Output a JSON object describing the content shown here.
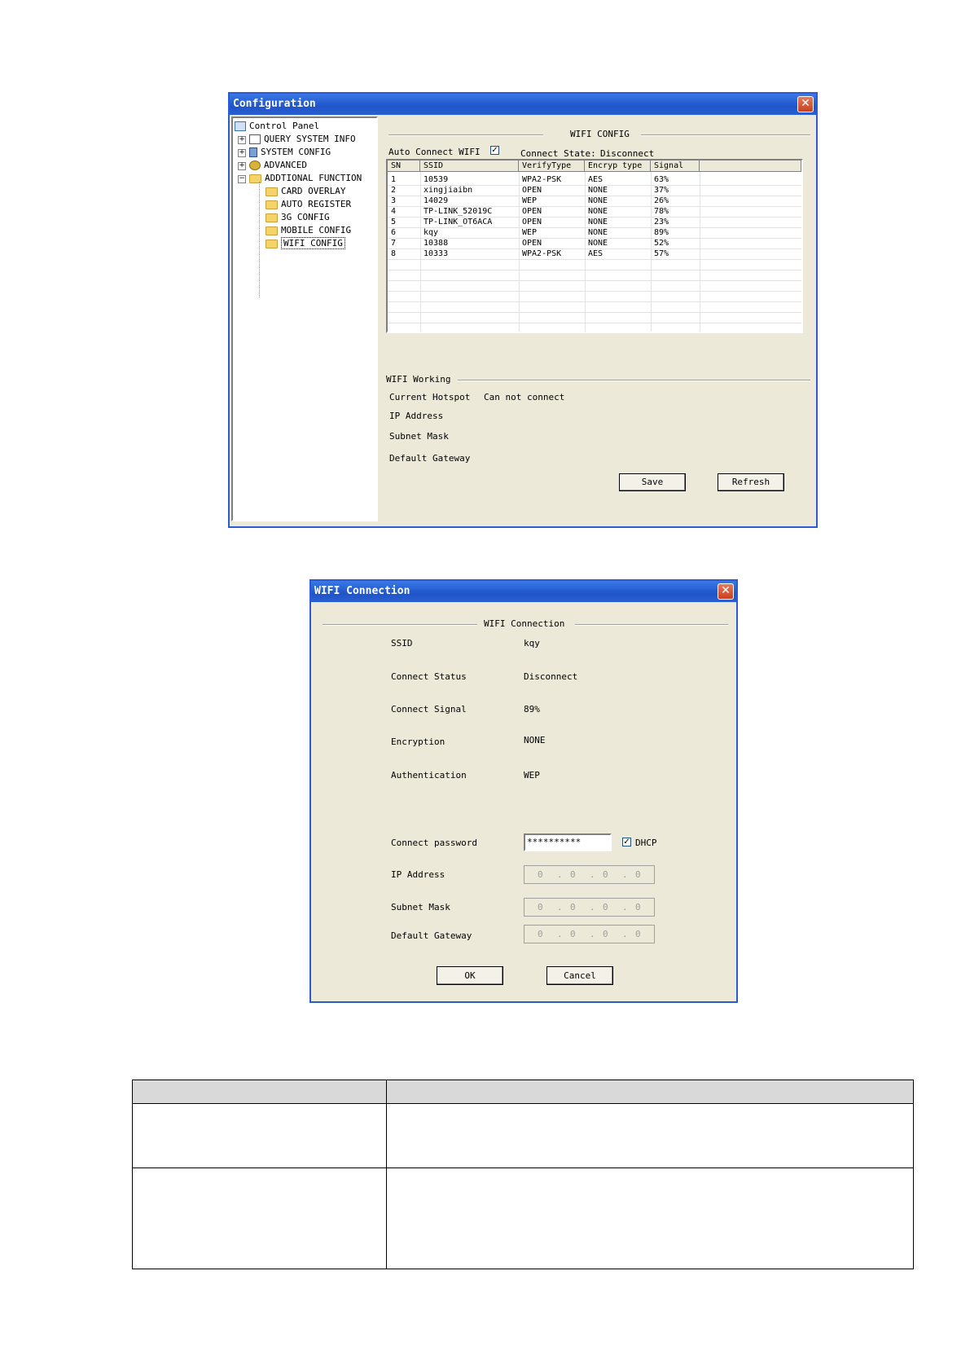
{
  "config_window": {
    "title": "Configuration",
    "tree": {
      "root": "Control Panel",
      "items": [
        {
          "label": "QUERY SYSTEM INFO"
        },
        {
          "label": "SYSTEM CONFIG"
        },
        {
          "label": "ADVANCED"
        },
        {
          "label": "ADDTIONAL FUNCTION"
        },
        {
          "label": "CARD OVERLAY"
        },
        {
          "label": "AUTO REGISTER"
        },
        {
          "label": "3G CONFIG"
        },
        {
          "label": "MOBILE CONFIG"
        },
        {
          "label": "WIFI CONFIG"
        }
      ]
    },
    "section_title": "WIFI CONFIG",
    "auto_connect_label": "Auto Connect WIFI",
    "auto_connect_checked": "✓",
    "connect_state_label": "Connect State:",
    "connect_state_value": "Disconnect",
    "table": {
      "headers": [
        "SN",
        "SSID",
        "VerifyType",
        "Encryp type",
        "Signal"
      ],
      "rows": [
        [
          "1",
          "10539",
          "WPA2-PSK",
          "AES",
          "63%"
        ],
        [
          "2",
          "xingjiaibn",
          "OPEN",
          "NONE",
          "37%"
        ],
        [
          "3",
          "14029",
          "WEP",
          "NONE",
          "26%"
        ],
        [
          "4",
          "TP-LINK_52019C",
          "OPEN",
          "NONE",
          "78%"
        ],
        [
          "5",
          "TP-LINK_OT6ACA",
          "OPEN",
          "NONE",
          "23%"
        ],
        [
          "6",
          "kqy",
          "WEP",
          "NONE",
          "89%"
        ],
        [
          "7",
          "10388",
          "OPEN",
          "NONE",
          "52%"
        ],
        [
          "8",
          "10333",
          "WPA2-PSK",
          "AES",
          "57%"
        ]
      ]
    },
    "working_title": "WIFI Working",
    "current_hotspot_label": "Current Hotspot",
    "current_hotspot_value": "Can not connect",
    "ip_label": "IP Address",
    "mask_label": "Subnet Mask",
    "gateway_label": "Default Gateway",
    "save_label": "Save",
    "refresh_label": "Refresh",
    "close_glyph": "✕"
  },
  "connection_window": {
    "title": "WIFI Connection",
    "section_title": "WIFI Connection",
    "ssid_label": "SSID",
    "ssid_value": "kqy",
    "status_label": "Connect Status",
    "status_value": "Disconnect",
    "signal_label": "Connect Signal",
    "signal_value": "89%",
    "encryption_label": "Encryption",
    "encryption_value": "NONE",
    "auth_label": "Authentication",
    "auth_value": "WEP",
    "password_label": "Connect password",
    "password_value": "**********",
    "dhcp_label": "DHCP",
    "dhcp_checked": "✓",
    "ip_label": "IP Address",
    "mask_label": "Subnet Mask",
    "gateway_label": "Default Gateway",
    "ip_octets": [
      "0",
      "0",
      "0",
      "0"
    ],
    "ok_label": "OK",
    "cancel_label": "Cancel",
    "close_glyph": "✕"
  },
  "colors": {
    "window_bg": "#ece9d8",
    "titlebar": "#1f55c9",
    "close_button": "#c8401f",
    "table_header": "#d9d9d9"
  }
}
